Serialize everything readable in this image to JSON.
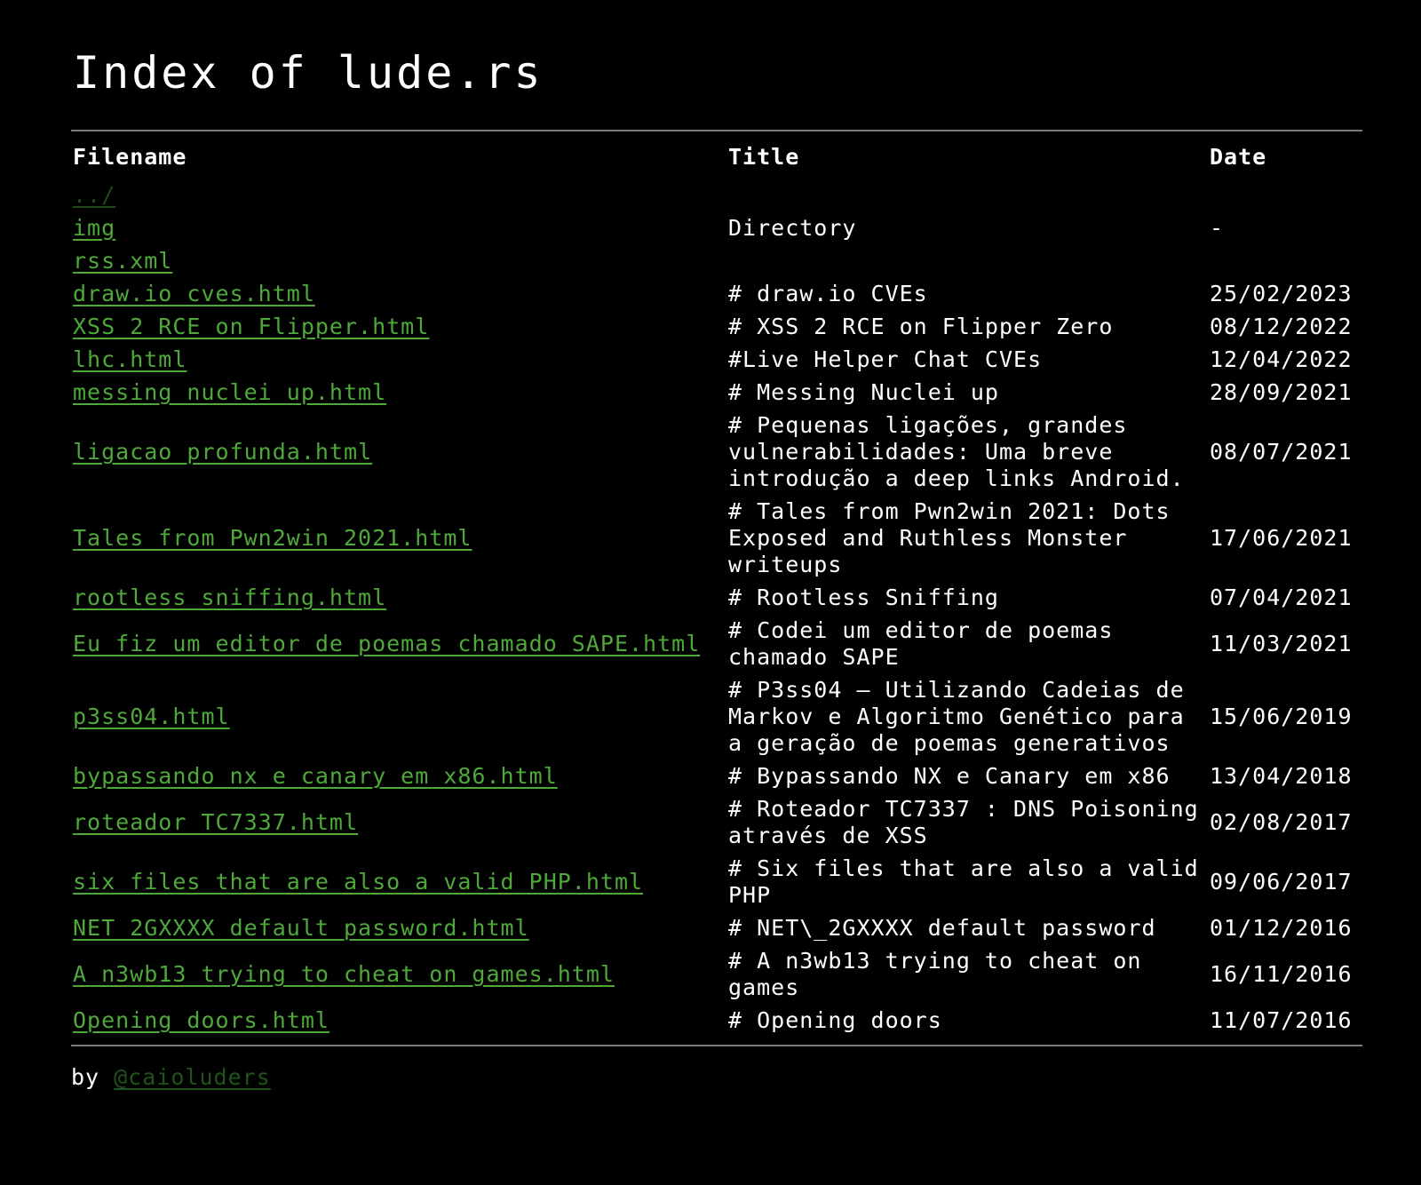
{
  "page": {
    "title": "Index of lude.rs"
  },
  "table": {
    "headers": {
      "filename": "Filename",
      "title": "Title",
      "date": "Date"
    },
    "parent_link": "../",
    "rows": [
      {
        "filename": "img",
        "title": "Directory",
        "date": "-"
      },
      {
        "filename": "rss.xml",
        "title": "",
        "date": ""
      },
      {
        "filename": "draw.io_cves.html",
        "title": "# draw.io CVEs",
        "date": "25/02/2023"
      },
      {
        "filename": "XSS_2_RCE_on_Flipper.html",
        "title": "# XSS 2 RCE on Flipper Zero",
        "date": "08/12/2022"
      },
      {
        "filename": "lhc.html",
        "title": "#Live Helper Chat CVEs",
        "date": "12/04/2022"
      },
      {
        "filename": "messing_nuclei_up.html",
        "title": "# Messing Nuclei up",
        "date": "28/09/2021"
      },
      {
        "filename": "ligacao_profunda.html",
        "title": "# Pequenas ligações, grandes vulnerabilidades: Uma breve introdução a deep links Android.",
        "date": "08/07/2021"
      },
      {
        "filename": "Tales_from_Pwn2win_2021.html",
        "title": "# Tales from Pwn2win 2021: Dots Exposed and Ruthless Monster writeups",
        "date": "17/06/2021"
      },
      {
        "filename": "rootless_sniffing.html",
        "title": "# Rootless Sniffing",
        "date": "07/04/2021"
      },
      {
        "filename": "Eu_fiz_um_editor_de_poemas_chamado_SAPE.html",
        "title": "# Codei um editor de poemas chamado SAPE",
        "date": "11/03/2021"
      },
      {
        "filename": "p3ss04.html",
        "title": "# P3ss04 – Utilizando Cadeias de Markov e Algoritmo Genético para a geração de poemas generativos",
        "date": "15/06/2019"
      },
      {
        "filename": "bypassando_nx_e_canary_em_x86.html",
        "title": "# Bypassando NX e Canary em x86",
        "date": "13/04/2018"
      },
      {
        "filename": "roteador_TC7337.html",
        "title": "# Roteador TC7337 : DNS Poisoning através de XSS",
        "date": "02/08/2017"
      },
      {
        "filename": "six_files_that_are_also_a_valid_PHP.html",
        "title": "# Six files that are also a valid PHP",
        "date": "09/06/2017"
      },
      {
        "filename": "NET_2GXXXX_default_password.html",
        "title": "# NET\\_2GXXXX default password",
        "date": "01/12/2016"
      },
      {
        "filename": "A_n3wb13_trying_to_cheat_on_games.html",
        "title": "# A n3wb13 trying to cheat on games",
        "date": "16/11/2016"
      },
      {
        "filename": "Opening_doors.html",
        "title": "# Opening doors",
        "date": "11/07/2016"
      }
    ]
  },
  "footer": {
    "prefix": "by",
    "author_link": "@caioluders"
  },
  "colors": {
    "background": "#000000",
    "text": "#ffffff",
    "link": "#4ea83a",
    "visited_link": "#1f5419",
    "rule": "#7a7a7a"
  }
}
